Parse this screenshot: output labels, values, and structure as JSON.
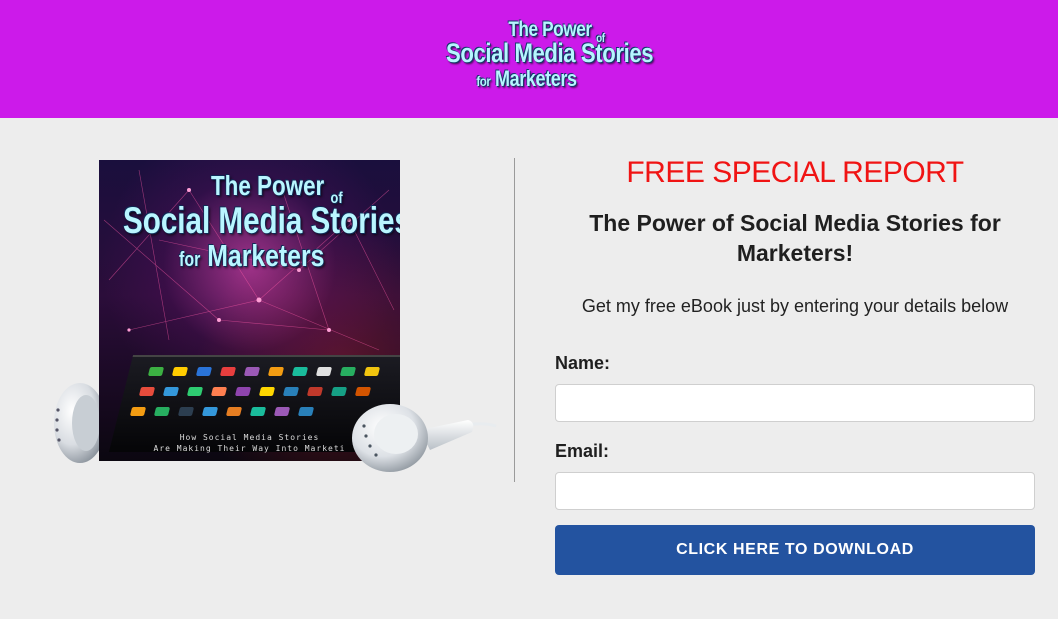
{
  "header": {
    "logo": {
      "line1": "The Power",
      "line1_of": "of",
      "line2": "Social Media Stories",
      "line3_for": "for",
      "line3": "Marketers"
    },
    "background": "#cc1aea"
  },
  "product": {
    "cover_title_line1": "The Power",
    "cover_title_of": "of",
    "cover_title_line2": "Social Media Stories",
    "cover_title_for": "for",
    "cover_title_line3": "Marketers",
    "cover_subtitle_line1": "How Social Media Stories",
    "cover_subtitle_line2": "Are Making Their Way Into Marketi"
  },
  "offer": {
    "title": "FREE SPECIAL REPORT",
    "headline": "The Power of Social Media Stories for Marketers!",
    "subtext": "Get my free eBook just by entering your details below"
  },
  "form": {
    "name_label": "Name:",
    "name_value": "",
    "email_label": "Email:",
    "email_value": "",
    "submit_label": "CLICK HERE TO DOWNLOAD"
  },
  "colors": {
    "accent_red": "#f01414",
    "button_blue": "#2353a0",
    "page_bg": "#ededed"
  }
}
